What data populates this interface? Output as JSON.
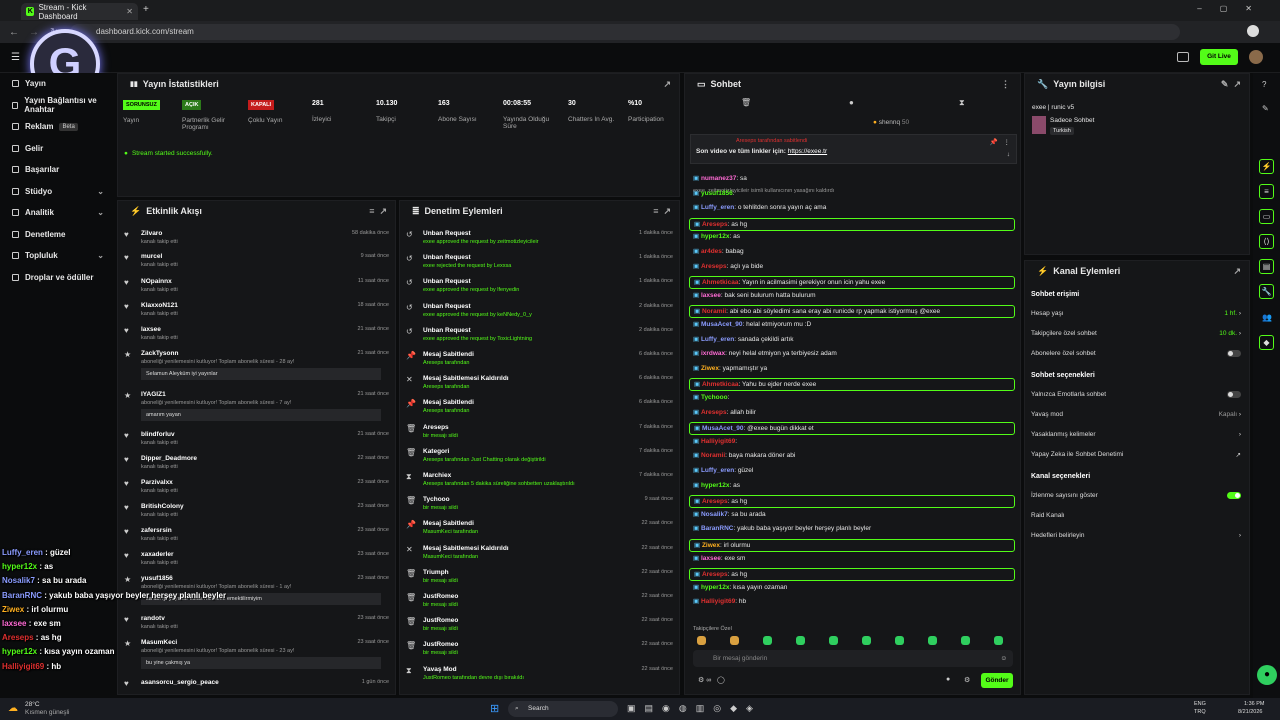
{
  "browser": {
    "tab_title": "Stream - Kick Dashboard",
    "url": "dashboard.kick.com/stream"
  },
  "topbar": {
    "live_button": "Git Live"
  },
  "sidebar": {
    "items": [
      {
        "label": "Yayın",
        "icon": "video-icon"
      },
      {
        "label": "Yayın Bağlantısı ve Anahtar",
        "icon": "key-icon"
      },
      {
        "label": "Reklam",
        "icon": "ad-icon",
        "badge": "Beta"
      },
      {
        "label": "Gelir",
        "icon": "money-icon"
      },
      {
        "label": "Başarılar",
        "icon": "trophy-icon"
      },
      {
        "label": "Stüdyo",
        "icon": "studio-icon",
        "chev": true
      },
      {
        "label": "Analitik",
        "icon": "chart-icon",
        "chev": true
      },
      {
        "label": "Denetleme",
        "icon": "shield-icon"
      },
      {
        "label": "Topluluk",
        "icon": "users-icon",
        "chev": true
      },
      {
        "label": "Droplar ve ödüller",
        "icon": "gift-icon"
      }
    ]
  },
  "stats": {
    "title": "Yayın İstatistikleri",
    "items": [
      {
        "value": "SORUNSUZ",
        "label": "Yayın",
        "tag": true,
        "color": "#53fc18"
      },
      {
        "value": "AÇIK",
        "label": "Partnerlik Gelir Programı",
        "tag": true,
        "color": "#2c7a1a"
      },
      {
        "value": "KAPALI",
        "label": "Çoklu Yayın",
        "tag": true,
        "color": "#c41c1c"
      },
      {
        "value": "281",
        "label": "İzleyici"
      },
      {
        "value": "10.130",
        "label": "Takipçi"
      },
      {
        "value": "163",
        "label": "Abone Sayısı"
      },
      {
        "value": "00:08:55",
        "label": "Yayında Olduğu Süre"
      },
      {
        "value": "30",
        "label": "Chatters In Avg."
      },
      {
        "value": "%10",
        "label": "Participation"
      }
    ],
    "status": "Stream started successfully."
  },
  "activity": {
    "title": "Etkinlik Akışı",
    "items": [
      {
        "name": "Zilvaro",
        "sub": "kanalı takip etti",
        "time": "58 dakika önce",
        "icon": "heart"
      },
      {
        "name": "murcel",
        "sub": "kanalı takip etti",
        "time": "9 saat önce",
        "icon": "heart"
      },
      {
        "name": "NOpainnx",
        "sub": "kanalı takip etti",
        "time": "11 saat önce",
        "icon": "heart"
      },
      {
        "name": "KlaxxoN121",
        "sub": "kanalı takip etti",
        "time": "18 saat önce",
        "icon": "heart"
      },
      {
        "name": "laxsee",
        "sub": "kanalı takip etti",
        "time": "21 saat önce",
        "icon": "heart"
      },
      {
        "name": "ZackTysonn",
        "sub": "aboneliği yenilemesini kutluyor! Toplam abonelik süresi - 28 ay!",
        "time": "21 saat önce",
        "icon": "star",
        "msg": "Selamun Aleyküm iyi yayınlar"
      },
      {
        "name": "IYAGIZ1",
        "sub": "aboneliği yenilemesini kutluyor! Toplam abonelik süresi - 7 ay!",
        "time": "21 saat önce",
        "icon": "star",
        "msg": "amarım yayan"
      },
      {
        "name": "blindforluv",
        "sub": "kanalı takip etti",
        "time": "21 saat önce",
        "icon": "heart"
      },
      {
        "name": "Dipper_Deadmore",
        "sub": "kanalı takip etti",
        "time": "22 saat önce",
        "icon": "heart"
      },
      {
        "name": "Parzivalxx",
        "sub": "kanalı takip etti",
        "time": "23 saat önce",
        "icon": "heart"
      },
      {
        "name": "BritishColony",
        "sub": "kanalı takip etti",
        "time": "23 saat önce",
        "icon": "heart"
      },
      {
        "name": "zafersrsin",
        "sub": "kanalı takip etti",
        "time": "23 saat önce",
        "icon": "heart"
      },
      {
        "name": "xaxaderler",
        "sub": "kanalı takip etti",
        "time": "23 saat önce",
        "icon": "heart"
      },
      {
        "name": "yusuf1856",
        "sub": "aboneliği yenilemesini kutluyor! Toplam abonelik süresi - 1 ay!",
        "time": "23 saat önce",
        "icon": "star",
        "msg": "sa abi iyi yayınlar kulak mernemi emektilirmiyim"
      },
      {
        "name": "randotv",
        "sub": "kanalı takip etti",
        "time": "23 saat önce",
        "icon": "heart"
      },
      {
        "name": "MasumKeci",
        "sub": "aboneliği yenilemesini kutluyor! Toplam abonelik süresi - 23 ay!",
        "time": "23 saat önce",
        "icon": "star",
        "msg": "bu yine çakmış ya"
      },
      {
        "name": "asansorcu_sergio_peace",
        "sub": "",
        "time": "1 gün önce",
        "icon": "heart"
      }
    ]
  },
  "moderation": {
    "title": "Denetim Eylemleri",
    "items": [
      {
        "name": "Unban Request",
        "sub": "exee approved the request by zeitmotizleyicileir",
        "time": "1 dakika önce",
        "icon": "↺"
      },
      {
        "name": "Unban Request",
        "sub": "exee rejected the request by Lexxsa",
        "time": "1 dakika önce",
        "icon": "↺"
      },
      {
        "name": "Unban Request",
        "sub": "exee approved the request by lfenyedin",
        "time": "1 dakika önce",
        "icon": "↺"
      },
      {
        "name": "Unban Request",
        "sub": "exee approved the request by keNNedy_0_y",
        "time": "2 dakika önce",
        "icon": "↺"
      },
      {
        "name": "Unban Request",
        "sub": "exee approved the request by ToxicLightning",
        "time": "2 dakika önce",
        "icon": "↺"
      },
      {
        "name": "Mesaj Sabitlendi",
        "sub": "Areseps tarafından",
        "time": "6 dakika önce",
        "icon": "📌"
      },
      {
        "name": "Mesaj Sabitlemesi Kaldırıldı",
        "sub": "Areseps tarafından",
        "time": "6 dakika önce",
        "icon": "✕"
      },
      {
        "name": "Mesaj Sabitlendi",
        "sub": "Areseps tarafından",
        "time": "6 dakika önce",
        "icon": "📌"
      },
      {
        "name": "Areseps",
        "sub": "bir mesajı sildi",
        "time": "7 dakika önce",
        "icon": "🗑"
      },
      {
        "name": "Kategori",
        "sub": "Areseps tarafından Just Chatting olarak değiştirildi",
        "time": "7 dakika önce",
        "icon": "🗑"
      },
      {
        "name": "Marchiex",
        "sub": "Areseps tarafından 5 dakika süreliğine sohbetten uzaklaştırıldı",
        "time": "7 dakika önce",
        "icon": "⧗"
      },
      {
        "name": "Tychooo",
        "sub": "bir mesajı sildi",
        "time": "9 saat önce",
        "icon": "🗑"
      },
      {
        "name": "Mesaj Sabitlendi",
        "sub": "MasumKeci tarafından",
        "time": "22 saat önce",
        "icon": "📌"
      },
      {
        "name": "Mesaj Sabitlemesi Kaldırıldı",
        "sub": "MasumKeci tarafından",
        "time": "22 saat önce",
        "icon": "✕"
      },
      {
        "name": "Triumph",
        "sub": "bir mesajı sildi",
        "time": "22 saat önce",
        "icon": "🗑"
      },
      {
        "name": "JustRomeo",
        "sub": "bir mesajı sildi",
        "time": "22 saat önce",
        "icon": "🗑"
      },
      {
        "name": "JustRomeo",
        "sub": "bir mesajı sildi",
        "time": "22 saat önce",
        "icon": "🗑"
      },
      {
        "name": "JustRomeo",
        "sub": "bir mesajı sildi",
        "time": "22 saat önce",
        "icon": "🗑"
      },
      {
        "name": "Yavaş Mod",
        "sub": "JustRomeo tarafından devre dışı bırakıldı",
        "time": "22 saat önce",
        "icon": "⧗"
      }
    ]
  },
  "chat": {
    "title": "Sohbet",
    "pinned_by": "Areseps tarafından sabitlendi",
    "pinned_text": "Son video ve tüm linkler için:",
    "pinned_link": "https://exee.tr",
    "top_user": "shennq",
    "top_count": "50",
    "system": "exee, zeitmotizleyicileir isimli kullanıcının yasağını kaldırdı",
    "messages": [
      {
        "u": "numanez37",
        "t": "sa",
        "c": "#ff6bd5"
      },
      {
        "u": "yusuf1856",
        "t": "",
        "c": "#53fc18"
      },
      {
        "u": "Luffy_eren",
        "t": "o tehlitden sonra yayın aç ama",
        "c": "#8b9cff"
      },
      {
        "u": "Areseps",
        "t": "as hg",
        "c": "#e03030",
        "hl": true
      },
      {
        "u": "hyper12x",
        "t": "as",
        "c": "#53fc18"
      },
      {
        "u": "ar4des",
        "t": "babag",
        "c": "#e03030"
      },
      {
        "u": "Areseps",
        "t": "açlı ya bide",
        "c": "#e03030"
      },
      {
        "u": "Ahmetkicaa",
        "t": "Yayın in acilmasimi gerekiyor onun icin yahu exee",
        "c": "#e03030",
        "hl": true
      },
      {
        "u": "laxsee",
        "t": "bak seni bulurum hatta bulurum",
        "c": "#ff6bd5"
      },
      {
        "u": "Noramii",
        "t": "abi ebo abi söyledimi sana eray abi runicde rp yapmak istiyormuş @exee",
        "c": "#e03030",
        "hl": true
      },
      {
        "u": "MusaAcet_90",
        "t": "helal etmiyorum mu :D",
        "c": "#8b9cff"
      },
      {
        "u": "Luffy_eren",
        "t": "sanada çekildi artık",
        "c": "#8b9cff"
      },
      {
        "u": "ixrdwax",
        "t": "neyi helal etmiyon ya terbiyesiz adam",
        "c": "#ff6bd5"
      },
      {
        "u": "Ziwex",
        "t": "yapmamıştır ya",
        "c": "#ffb020"
      },
      {
        "u": "Ahmetkicaa",
        "t": "Yahu bu ejder nerde exee",
        "c": "#e03030",
        "hl": true
      },
      {
        "u": "Tychooo",
        "t": "",
        "c": "#53fc18"
      },
      {
        "u": "Areseps",
        "t": "allah bilir",
        "c": "#e03030"
      },
      {
        "u": "MusaAcet_90",
        "t": "@exee bugün dikkat et",
        "c": "#8b9cff",
        "hl": true
      },
      {
        "u": "Halliyigit69",
        "t": "",
        "c": "#e03030"
      },
      {
        "u": "Noramii",
        "t": "baya makara döner abi",
        "c": "#e03030"
      },
      {
        "u": "Luffy_eren",
        "t": "güzel",
        "c": "#8b9cff"
      },
      {
        "u": "hyper12x",
        "t": "as",
        "c": "#53fc18"
      },
      {
        "u": "Areseps",
        "t": "as hg",
        "c": "#e03030",
        "hl": true
      },
      {
        "u": "Nosalik7",
        "t": "sa bu arada",
        "c": "#8b9cff"
      },
      {
        "u": "BaranRNC",
        "t": "yakub baba yaşıyor beyler herşey planlı beyler",
        "c": "#8b9cff"
      },
      {
        "u": "Ziwex",
        "t": "irl olurmu",
        "c": "#ffb020",
        "hl": true
      },
      {
        "u": "laxsee",
        "t": "exe sm",
        "c": "#ff6bd5"
      },
      {
        "u": "Areseps",
        "t": "as hg",
        "c": "#e03030",
        "hl": true
      },
      {
        "u": "hyper12x",
        "t": "kısa yayın ozaman",
        "c": "#53fc18"
      },
      {
        "u": "Halliyigit69",
        "t": "hb",
        "c": "#e03030"
      }
    ],
    "followers_only": "Takipçilere Özel",
    "input_placeholder": "Bir mesaj gönderin",
    "send": "Gönder"
  },
  "info": {
    "title": "Yayın bilgisi",
    "stream_title": "exee | runic v5",
    "mode": "Sadece Sohbet",
    "lang": "Turkish"
  },
  "actions": {
    "title": "Kanal Eylemleri",
    "sections": [
      {
        "h": "Sohbet erişimi",
        "rows": [
          {
            "l": "Hesap yaşı",
            "v": "1 hf.",
            "type": "green"
          },
          {
            "l": "Takipçilere özel sohbet",
            "v": "10 dk.",
            "type": "green"
          },
          {
            "l": "Abonelere özel sohbet",
            "type": "off"
          }
        ]
      },
      {
        "h": "Sohbet seçenekleri",
        "rows": [
          {
            "l": "Yalnızca Emotlarla sohbet",
            "type": "off"
          },
          {
            "l": "Yavaş mod",
            "v": "Kapalı",
            "type": "gray"
          },
          {
            "l": "Yasaklanmış kelimeler",
            "type": "chev"
          },
          {
            "l": "Yapay Zeka ile Sohbet Denetimi",
            "type": "ext"
          }
        ]
      },
      {
        "h": "Kanal seçenekleri",
        "rows": [
          {
            "l": "İzlenme sayısını göster",
            "type": "on"
          },
          {
            "l": "Raid Kanalı",
            "type": "none"
          },
          {
            "l": "Hedefleri belirleyin",
            "type": "chev"
          }
        ]
      }
    ]
  },
  "overlay": [
    {
      "u": "Luffy_eren",
      "t": "güzel",
      "c": "#8b9cff"
    },
    {
      "u": "hyper12x",
      "t": "as",
      "c": "#53fc18"
    },
    {
      "u": "Nosalik7",
      "t": "sa bu arada",
      "c": "#8b9cff"
    },
    {
      "u": "BaranRNC",
      "t": "yakub baba yaşıyor beyler herşey planlı beyler",
      "c": "#8b9cff"
    },
    {
      "u": "Ziwex",
      "t": "irl olurmu",
      "c": "#ffb020"
    },
    {
      "u": "laxsee",
      "t": "exe sm",
      "c": "#ff6bd5"
    },
    {
      "u": "Areseps",
      "t": "as hg",
      "c": "#e03030"
    },
    {
      "u": "hyper12x",
      "t": "kısa yayın ozaman",
      "c": "#53fc18"
    },
    {
      "u": "Halliyigit69",
      "t": "hb",
      "c": "#e03030"
    }
  ],
  "taskbar": {
    "weather_temp": "28°C",
    "weather_desc": "Kısmen güneşli",
    "search": "Search",
    "lang1": "ENG",
    "lang2": "TRQ",
    "time": "1:36 PM",
    "date": "8/21/2026"
  }
}
